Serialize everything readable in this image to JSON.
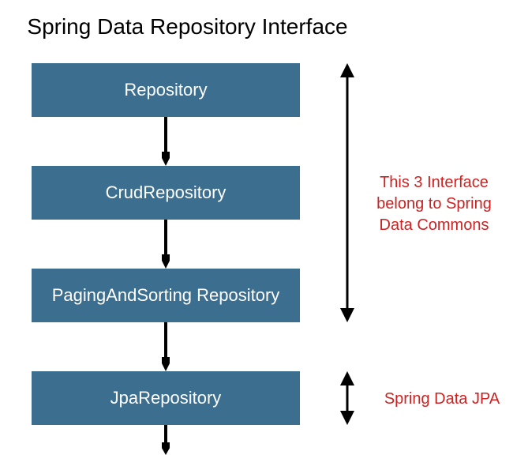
{
  "title": "Spring Data Repository Interface",
  "boxes": {
    "b1": "Repository",
    "b2": "CrudRepository",
    "b3": "PagingAndSorting Repository",
    "b4": "JpaRepository"
  },
  "annotations": {
    "a1": "This 3 Interface belong to Spring Data Commons",
    "a2": "Spring Data JPA"
  },
  "colors": {
    "box_bg": "#3b6e8f",
    "box_text": "#ffffff",
    "annotation_text": "#cc2222"
  }
}
